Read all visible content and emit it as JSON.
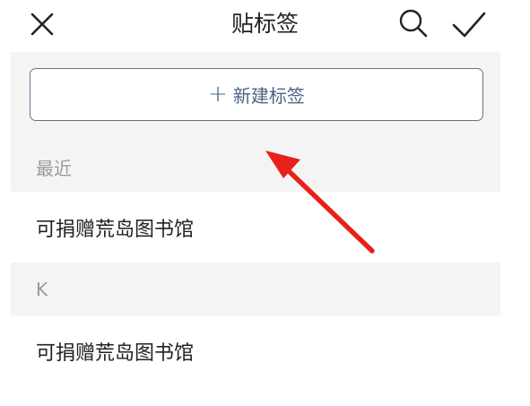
{
  "header": {
    "title": "贴标签",
    "close_icon": "close-icon",
    "search_icon": "search-icon",
    "confirm_icon": "checkmark-icon"
  },
  "new_tag_button": {
    "plus": "+",
    "label": "新建标签"
  },
  "sections": [
    {
      "label": "最近",
      "items": [
        "可捐赠荒岛图书馆"
      ]
    },
    {
      "label": "K",
      "items": [
        "可捐赠荒岛图书馆"
      ]
    }
  ],
  "colors": {
    "accent": "#4d6384",
    "section_bg": "#f4f4f4",
    "arrow": "#e8201c"
  }
}
